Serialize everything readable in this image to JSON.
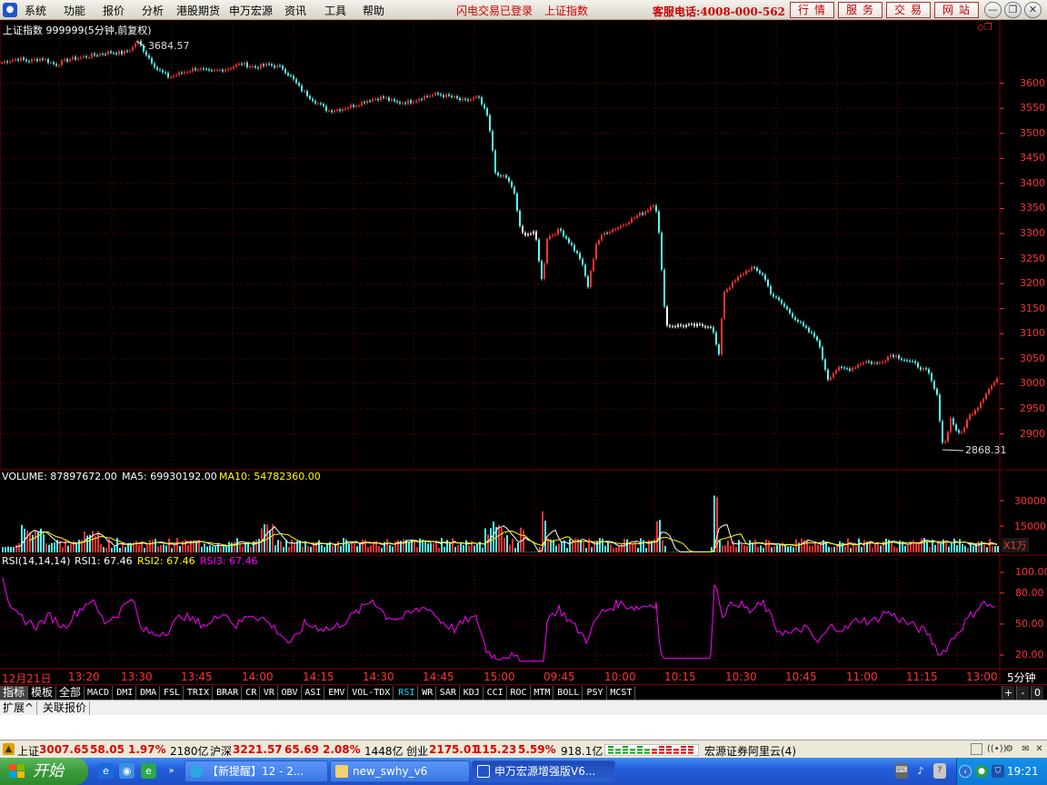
{
  "menu": {
    "items": [
      "系统",
      "功能",
      "报价",
      "分析",
      "港股期货",
      "申万宏源",
      "资讯",
      "工具",
      "帮助"
    ],
    "notice_login": "闪电交易已登录",
    "notice_index": "上证指数",
    "hotline": "客服电话:4008-000-562",
    "buttons": [
      "行情",
      "服务",
      "交易",
      "网站"
    ]
  },
  "chart_header": {
    "title": "上证指数 999999(5分钟,前复权)",
    "high_label": "3684.57",
    "low_label": "2868.31"
  },
  "price_axis": {
    "ticks": [
      "3600",
      "3550",
      "3500",
      "3450",
      "3400",
      "3350",
      "3300",
      "3250",
      "3200",
      "3150",
      "3100",
      "3050",
      "3000",
      "2950",
      "2900"
    ]
  },
  "volume_panel": {
    "label": "VOLUME: 87897672.00",
    "ma5": "MA5: 69930192.00",
    "ma10": "MA10: 54782360.00",
    "ticks": [
      "30000",
      "15000"
    ],
    "unit": "X1万"
  },
  "rsi_panel": {
    "label": "RSI(14,14,14)",
    "rsi1": "RSI1: 67.46",
    "rsi2": "RSI2: 67.46",
    "rsi3": "RSI3: 67.46",
    "ticks": [
      "100.00",
      "80.00",
      "50.00",
      "20.00"
    ]
  },
  "time_axis": {
    "labels": [
      "12月21日",
      "13:20",
      "13:30",
      "13:45",
      "14:00",
      "14:15",
      "14:30",
      "14:45",
      "15:00",
      "09:45",
      "10:00",
      "10:15",
      "10:30",
      "10:45",
      "11:00",
      "11:15",
      "13:00"
    ],
    "period": "5分钟"
  },
  "indicator_tabs": [
    "指标",
    "模板",
    "全部",
    "MACD",
    "DMI",
    "DMA",
    "FSL",
    "TRIX",
    "BRAR",
    "CR",
    "VR",
    "OBV",
    "ASI",
    "EMV",
    "VOL-TDX",
    "RSI",
    "WR",
    "SAR",
    "KDJ",
    "CCI",
    "ROC",
    "MTM",
    "BOLL",
    "PSY",
    "MCST"
  ],
  "active_tab": "RSI",
  "tab_controls": [
    "+",
    "-",
    "0"
  ],
  "ext_tabs": [
    "扩展^",
    "关联报价"
  ],
  "ticker": {
    "sh_name": "上证",
    "sh_value": "3007.65",
    "sh_change": "58.05",
    "sh_pct": "1.97%",
    "sh_amount": "2180亿",
    "hs_name": "沪深",
    "hs_value": "3221.57",
    "hs_change": "65.69",
    "hs_pct": "2.08%",
    "hs_amount": "1448亿",
    "cy_name": "创业",
    "cy_value": "2175.01",
    "cy_change": "115.23",
    "cy_pct": "5.59%",
    "cy_amount": "918.1亿",
    "broker": "宏源证券阿里云(4)"
  },
  "taskbar": {
    "start": "开始",
    "tasks": [
      "【新提醒】12 - 2...",
      "new_swhy_v6",
      "申万宏源增强版V6..."
    ],
    "clock": "19:21"
  },
  "colors": {
    "up": "#ff3232",
    "down": "#54fcfc",
    "grid": "#7a0000",
    "rsi": "#ff00ff",
    "ma10": "#ffff00"
  },
  "chart_data": {
    "type": "line",
    "title": "上证指数 999999(5分钟,前复权)",
    "price_series_approx": [
      [
        0,
        3641
      ],
      [
        10,
        3646
      ],
      [
        20,
        3649
      ],
      [
        30,
        3644
      ],
      [
        45,
        3650
      ],
      [
        60,
        3637
      ],
      [
        75,
        3648
      ],
      [
        90,
        3652
      ],
      [
        105,
        3657
      ],
      [
        120,
        3662
      ],
      [
        135,
        3660
      ],
      [
        145,
        3671
      ],
      [
        150,
        3685
      ],
      [
        160,
        3658
      ],
      [
        172,
        3628
      ],
      [
        185,
        3612
      ],
      [
        200,
        3621
      ],
      [
        215,
        3630
      ],
      [
        230,
        3622
      ],
      [
        250,
        3630
      ],
      [
        265,
        3639
      ],
      [
        280,
        3632
      ],
      [
        295,
        3637
      ],
      [
        310,
        3630
      ],
      [
        320,
        3611
      ],
      [
        330,
        3588
      ],
      [
        345,
        3565
      ],
      [
        360,
        3545
      ],
      [
        375,
        3549
      ],
      [
        390,
        3557
      ],
      [
        405,
        3567
      ],
      [
        420,
        3572
      ],
      [
        435,
        3561
      ],
      [
        450,
        3563
      ],
      [
        465,
        3573
      ],
      [
        480,
        3578
      ],
      [
        495,
        3573
      ],
      [
        510,
        3564
      ],
      [
        525,
        3572
      ],
      [
        535,
        3535
      ],
      [
        540,
        3480
      ],
      [
        545,
        3411
      ],
      [
        555,
        3416
      ],
      [
        565,
        3380
      ],
      [
        572,
        3300
      ],
      [
        588,
        3300
      ],
      [
        596,
        3195
      ],
      [
        600,
        3290
      ],
      [
        615,
        3308
      ],
      [
        625,
        3284
      ],
      [
        638,
        3248
      ],
      [
        646,
        3194
      ],
      [
        655,
        3280
      ],
      [
        665,
        3303
      ],
      [
        680,
        3313
      ],
      [
        695,
        3330
      ],
      [
        710,
        3345
      ],
      [
        720,
        3363
      ],
      [
        724,
        3300
      ],
      [
        728,
        3200
      ],
      [
        732,
        3116
      ],
      [
        782,
        3116
      ],
      [
        790,
        3055
      ],
      [
        795,
        3183
      ],
      [
        805,
        3200
      ],
      [
        815,
        3218
      ],
      [
        825,
        3232
      ],
      [
        838,
        3219
      ],
      [
        848,
        3178
      ],
      [
        858,
        3162
      ],
      [
        870,
        3138
      ],
      [
        885,
        3110
      ],
      [
        898,
        3090
      ],
      [
        910,
        3010
      ],
      [
        920,
        3030
      ],
      [
        935,
        3030
      ],
      [
        950,
        3045
      ],
      [
        965,
        3040
      ],
      [
        980,
        3059
      ],
      [
        990,
        3052
      ],
      [
        1005,
        3040
      ],
      [
        1020,
        3023
      ],
      [
        1030,
        2975
      ],
      [
        1037,
        2869
      ],
      [
        1045,
        2930
      ],
      [
        1055,
        2895
      ],
      [
        1065,
        2935
      ],
      [
        1075,
        2955
      ],
      [
        1085,
        2985
      ],
      [
        1095,
        3007
      ]
    ],
    "volume_approx_bars": 365,
    "rsi_approx": [
      [
        3,
        98
      ],
      [
        12,
        62
      ],
      [
        25,
        55
      ],
      [
        40,
        48
      ],
      [
        55,
        58
      ],
      [
        70,
        47
      ],
      [
        85,
        62
      ],
      [
        100,
        74
      ],
      [
        115,
        52
      ],
      [
        130,
        60
      ],
      [
        145,
        78
      ],
      [
        155,
        45
      ],
      [
        170,
        40
      ],
      [
        185,
        44
      ],
      [
        200,
        59
      ],
      [
        215,
        52
      ],
      [
        230,
        49
      ],
      [
        245,
        63
      ],
      [
        260,
        48
      ],
      [
        275,
        60
      ],
      [
        290,
        55
      ],
      [
        305,
        44
      ],
      [
        320,
        30
      ],
      [
        335,
        50
      ],
      [
        350,
        47
      ],
      [
        365,
        45
      ],
      [
        380,
        53
      ],
      [
        395,
        63
      ],
      [
        410,
        74
      ],
      [
        425,
        58
      ],
      [
        440,
        55
      ],
      [
        455,
        62
      ],
      [
        470,
        67
      ],
      [
        485,
        53
      ],
      [
        500,
        45
      ],
      [
        515,
        55
      ],
      [
        525,
        55
      ],
      [
        535,
        25
      ],
      [
        545,
        18
      ],
      [
        560,
        20
      ],
      [
        572,
        14
      ],
      [
        598,
        14
      ],
      [
        602,
        55
      ],
      [
        615,
        65
      ],
      [
        630,
        50
      ],
      [
        645,
        35
      ],
      [
        660,
        60
      ],
      [
        680,
        70
      ],
      [
        700,
        66
      ],
      [
        722,
        70
      ],
      [
        727,
        20
      ],
      [
        733,
        17
      ],
      [
        782,
        17
      ],
      [
        786,
        92
      ],
      [
        795,
        60
      ],
      [
        810,
        72
      ],
      [
        825,
        62
      ],
      [
        840,
        70
      ],
      [
        855,
        45
      ],
      [
        870,
        40
      ],
      [
        885,
        47
      ],
      [
        900,
        32
      ],
      [
        915,
        48
      ],
      [
        930,
        45
      ],
      [
        945,
        55
      ],
      [
        960,
        52
      ],
      [
        975,
        62
      ],
      [
        990,
        55
      ],
      [
        1005,
        48
      ],
      [
        1020,
        42
      ],
      [
        1035,
        20
      ],
      [
        1050,
        38
      ],
      [
        1065,
        55
      ],
      [
        1080,
        70
      ],
      [
        1095,
        67
      ]
    ]
  }
}
